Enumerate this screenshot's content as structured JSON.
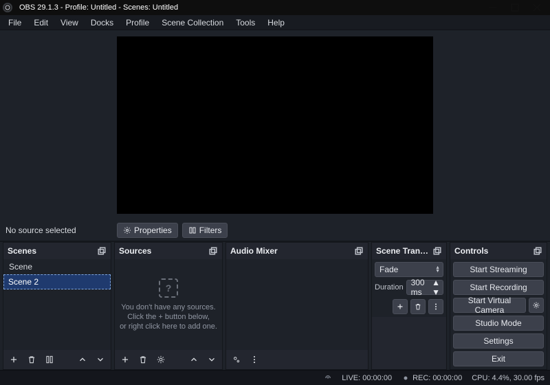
{
  "window": {
    "title": "OBS 29.1.3 - Profile: Untitled - Scenes: Untitled"
  },
  "menu": [
    "File",
    "Edit",
    "View",
    "Docks",
    "Profile",
    "Scene Collection",
    "Tools",
    "Help"
  ],
  "mid": {
    "no_source": "No source selected",
    "properties": "Properties",
    "filters": "Filters"
  },
  "scenes": {
    "title": "Scenes",
    "items": [
      {
        "label": "Scene",
        "selected": false
      },
      {
        "label": "Scene 2",
        "selected": true
      }
    ]
  },
  "sources": {
    "title": "Sources",
    "empty1": "You don't have any sources.",
    "empty2": "Click the + button below,",
    "empty3": "or right click here to add one."
  },
  "mixer": {
    "title": "Audio Mixer"
  },
  "transitions": {
    "title": "Scene Transitions",
    "current": "Fade",
    "duration_label": "Duration",
    "duration_value": "300 ms"
  },
  "controls": {
    "title": "Controls",
    "start_streaming": "Start Streaming",
    "start_recording": "Start Recording",
    "start_virtual_camera": "Start Virtual Camera",
    "studio_mode": "Studio Mode",
    "settings": "Settings",
    "exit": "Exit"
  },
  "status": {
    "live": "LIVE: 00:00:00",
    "rec": "REC: 00:00:00",
    "cpu": "CPU: 4.4%, 30.00 fps"
  }
}
